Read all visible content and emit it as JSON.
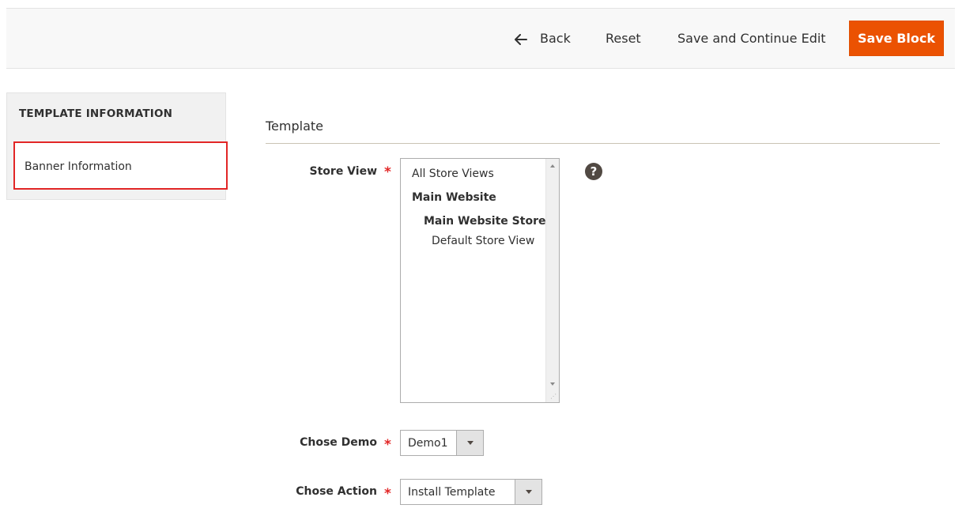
{
  "toolbar": {
    "back_label": "Back",
    "reset_label": "Reset",
    "save_continue_label": "Save and Continue Edit",
    "save_label": "Save Block",
    "accent_color": "#eb5202"
  },
  "sidebar": {
    "title": "TEMPLATE INFORMATION",
    "items": [
      {
        "label": "Banner Information",
        "active": true
      }
    ]
  },
  "form": {
    "section_title": "Template",
    "store_view": {
      "label": "Store View",
      "required_mark": "*",
      "options": [
        {
          "label": "All Store Views"
        },
        {
          "label": "Main Website"
        },
        {
          "label": "Main Website Store"
        },
        {
          "label": "Default Store View"
        }
      ],
      "help_icon": "question-icon",
      "help_glyph": "?"
    },
    "demo": {
      "label": "Chose Demo",
      "required_mark": "*",
      "value": "Demo1"
    },
    "action": {
      "label": "Chose Action",
      "required_mark": "*",
      "value": "Install Template"
    }
  }
}
